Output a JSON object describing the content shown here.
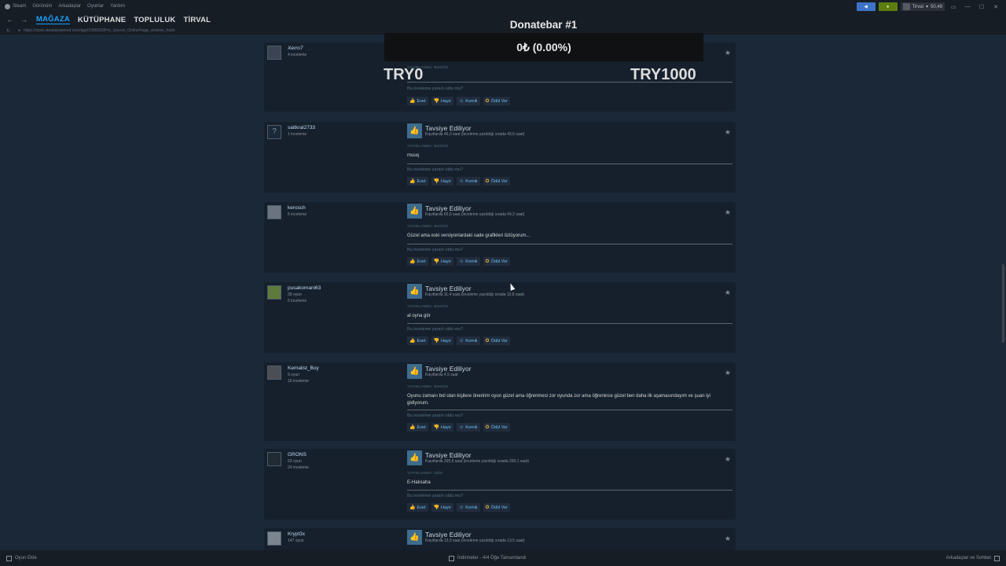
{
  "menubar": {
    "items": [
      "Steam",
      "Görünüm",
      "Arkadaşlar",
      "Oyunlar",
      "Yardım"
    ],
    "user_name": "Tirval",
    "balance": "50,48"
  },
  "nav": {
    "tabs": [
      "MAĞAZA",
      "KÜTÜPHANE",
      "TOPLULUK",
      "TİRVAL"
    ],
    "url": "https://store.steampowered.com/app/1585520/Pro_Soccer_Online/#app_reviews_hash"
  },
  "donatebar": {
    "title": "Donatebar #1",
    "amount": "0₺ (0.00%)",
    "min_label": "TRY0",
    "max_label": "TRY1000"
  },
  "review_ui": {
    "helpful_question": "Bu inceleme yararlı oldu mu?",
    "yes": "Evet",
    "no": "Hayır",
    "funny": "Komik",
    "award": "Ödül Ver"
  },
  "reviews": [
    {
      "user": "Xerro7",
      "stats": [
        "4 inceleme"
      ],
      "posted": "YAYINLANMA: BUGÜN"
    },
    {
      "user": "saitkral2733",
      "stats": [
        "1 inceleme"
      ],
      "verdict": "Tavsiye Ediliyor",
      "hours": "Kayıtlarda 46,3 saat (inceleme yazıldığı sırada 43,6 saat)",
      "posted": "YAYINLANMA: BUGÜN",
      "text": "muuq"
    },
    {
      "user": "kerosch",
      "stats": [
        "5 inceleme"
      ],
      "verdict": "Tavsiye Ediliyor",
      "hours": "Kayıtlarda 65,5 saat (inceleme yazıldığı sırada 64,2 saat)",
      "posted": "YAYINLANMA: BUGÜN",
      "text": "Güzel ama eski versiyonlardaki sade grafikleri özlüyorum..."
    },
    {
      "user": "pusakomani63",
      "stats": [
        "39 oyun",
        "5 inceleme"
      ],
      "verdict": "Tavsiye Ediliyor",
      "hours": "Kayıtlarda 11,4 saat (inceleme yazıldığı sırada 10,8 saat)",
      "posted": "YAYINLANMA: BUGÜN",
      "text": "al oyna gör"
    },
    {
      "user": "Kemalist_Boy",
      "stats": [
        "9 oyun",
        "16 inceleme"
      ],
      "verdict": "Tavsiye Ediliyor",
      "hours": "Kayıtlarda 4,5 saat",
      "posted": "YAYINLANMA: BUGÜN",
      "text": "Oyunu zamanı bol olan kişilere öneririm oyun güzel ama öğrenmesi zor oyunda zor ama öğrenince güzel ben daha ilk aşamasındayım ve şuan iyi gidiyorum."
    },
    {
      "user": "GRONS",
      "stats": [
        "63 oyun",
        "24 inceleme"
      ],
      "verdict": "Tavsiye Ediliyor",
      "hours": "Kayıtlarda 295,6 saat (inceleme yazıldığı sırada 295,1 saat)",
      "posted": "YAYINLANMA: DÜN",
      "text": "E-Halısaha"
    },
    {
      "user": "Krypt3x",
      "stats": [
        "147 oyun"
      ],
      "verdict": "Tavsiye Ediliyor",
      "hours": "Kayıtlarda 13,5 saat (inceleme yazıldığı sırada 13,5 saat)"
    }
  ],
  "bottombar": {
    "add_game": "Oyun Ekle",
    "downloads": "İndirmeler - 4/4 Öğe Tamamlandı",
    "friends": "Arkadaşlar ve Sohbet"
  },
  "colors": {
    "background": "#1b2838",
    "accent": "#1a9fff",
    "link": "#66c0f4",
    "recommend": "#3d6c8d"
  }
}
